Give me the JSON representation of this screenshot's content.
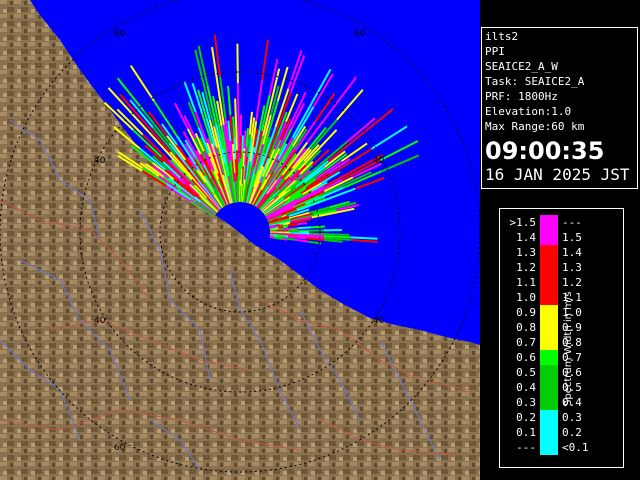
{
  "info": {
    "station": "ilts2",
    "product": "PPI",
    "scan_name": "SEAICE2_A_W",
    "task": "Task: SEAICE2_A",
    "prf": "PRF: 1800Hz",
    "elevation": "Elevation:1.0",
    "max_range": "Max Range:60 km",
    "time": "09:00:35",
    "date": "16 JAN 2025 JST"
  },
  "legend": {
    "title": "Spectrum Width in m/s",
    "rows": [
      {
        "left": ">1.5",
        "right": "---",
        "color": "#ff00ff"
      },
      {
        "left": "1.4",
        "right": "1.5",
        "color": "#ff00ff"
      },
      {
        "left": "1.3",
        "right": "1.4",
        "color": "#ff0000"
      },
      {
        "left": "1.2",
        "right": "1.3",
        "color": "#ff0000"
      },
      {
        "left": "1.1",
        "right": "1.2",
        "color": "#ff0000"
      },
      {
        "left": "1.0",
        "right": "1.1",
        "color": "#ff0000"
      },
      {
        "left": "0.9",
        "right": "1.0",
        "color": "#ffff00"
      },
      {
        "left": "0.8",
        "right": "0.9",
        "color": "#ffff00"
      },
      {
        "left": "0.7",
        "right": "0.8",
        "color": "#ffff00"
      },
      {
        "left": "0.6",
        "right": "0.7",
        "color": "#00ff00"
      },
      {
        "left": "0.5",
        "right": "0.6",
        "color": "#00cc00"
      },
      {
        "left": "0.4",
        "right": "0.5",
        "color": "#00cc00"
      },
      {
        "left": "0.3",
        "right": "0.4",
        "color": "#00cc00"
      },
      {
        "left": "0.2",
        "right": "0.3",
        "color": "#00ffff"
      },
      {
        "left": "0.1",
        "right": "0.2",
        "color": "#00ffff"
      },
      {
        "left": "---",
        "right": "<0.1",
        "color": "#00ffff"
      }
    ]
  },
  "range_ring_labels": [
    "60",
    "60",
    "40",
    "40",
    "40",
    "40",
    "60"
  ],
  "colors": {
    "sea": "#0000ff",
    "land": "#8b7152",
    "rings": "#000000"
  }
}
